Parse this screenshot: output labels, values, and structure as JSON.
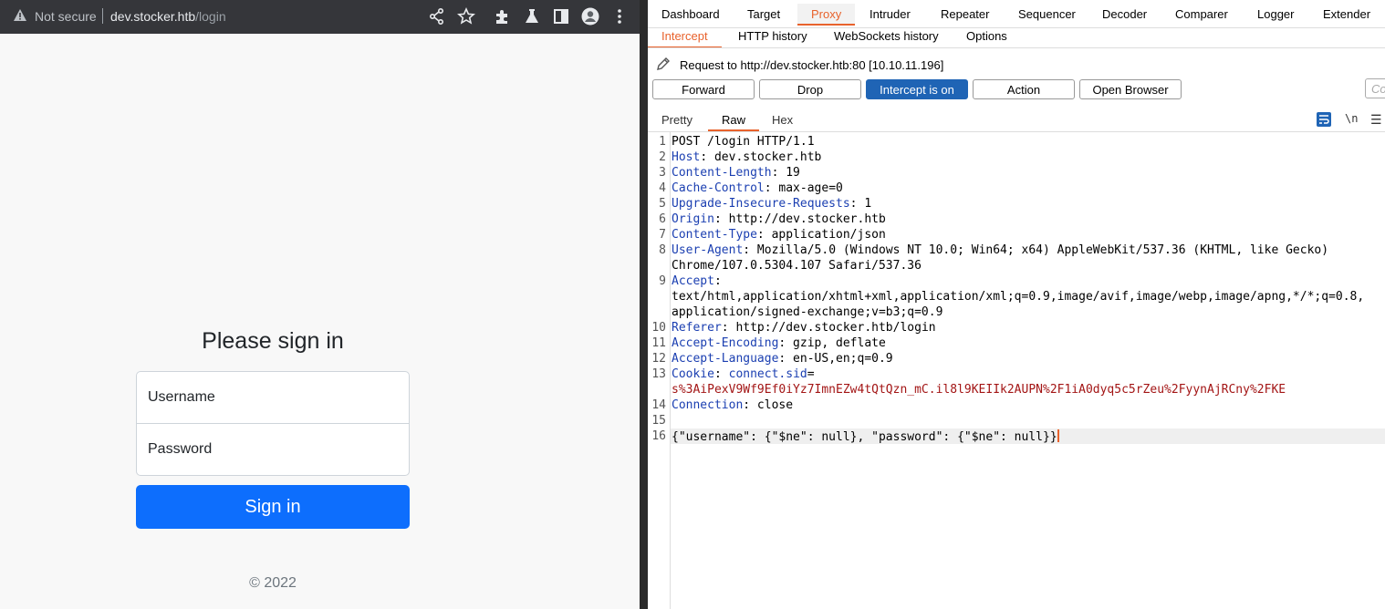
{
  "browser": {
    "security_label": "Not secure",
    "url_host": "dev.stocker.htb",
    "url_path": "/login",
    "toolbar_icons": [
      "share-icon",
      "star-icon",
      "extensions-icon",
      "labs-icon",
      "sidepanel-icon",
      "profile-icon",
      "menu-icon"
    ],
    "page": {
      "title": "Please sign in",
      "username_placeholder": "Username",
      "password_placeholder": "Password",
      "signin_label": "Sign in",
      "copyright": "© 2022"
    }
  },
  "burp": {
    "main_tabs": [
      "Dashboard",
      "Target",
      "Proxy",
      "Intruder",
      "Repeater",
      "Sequencer",
      "Decoder",
      "Comparer",
      "Logger",
      "Extender"
    ],
    "main_active": "Proxy",
    "sub_tabs": [
      "Intercept",
      "HTTP history",
      "WebSockets history",
      "Options"
    ],
    "sub_active": "Intercept",
    "request_info": "Request to http://dev.stocker.htb:80  [10.10.11.196]",
    "buttons": {
      "forward": "Forward",
      "drop": "Drop",
      "intercept": "Intercept is on",
      "action": "Action",
      "open_browser": "Open Browser"
    },
    "comment_placeholder": "Co",
    "view_tabs": [
      "Pretty",
      "Raw",
      "Hex"
    ],
    "view_active": "Raw",
    "view_icons": {
      "newline_label": "\\n"
    },
    "request_lines": [
      {
        "n": "1",
        "text": "POST /login HTTP/1.1"
      },
      {
        "n": "2",
        "key": "Host",
        "val": " dev.stocker.htb"
      },
      {
        "n": "3",
        "key": "Content-Length",
        "val": " 19"
      },
      {
        "n": "4",
        "key": "Cache-Control",
        "val": " max-age=0"
      },
      {
        "n": "5",
        "key": "Upgrade-Insecure-Requests",
        "val": " 1"
      },
      {
        "n": "6",
        "key": "Origin",
        "val": " http://dev.stocker.htb"
      },
      {
        "n": "7",
        "key": "Content-Type",
        "val": " application/json"
      },
      {
        "n": "8",
        "key": "User-Agent",
        "val": " Mozilla/5.0 (Windows NT 10.0; Win64; x64) AppleWebKit/537.36 (KHTML, like Gecko)",
        "cont": [
          "Chrome/107.0.5304.107 Safari/537.36"
        ]
      },
      {
        "n": "9",
        "key": "Accept",
        "val": "",
        "cont": [
          "text/html,application/xhtml+xml,application/xml;q=0.9,image/avif,image/webp,image/apng,*/*;q=0.8,",
          "application/signed-exchange;v=b3;q=0.9"
        ]
      },
      {
        "n": "10",
        "key": "Referer",
        "val": " http://dev.stocker.htb/login"
      },
      {
        "n": "11",
        "key": "Accept-Encoding",
        "val": " gzip, deflate"
      },
      {
        "n": "12",
        "key": "Accept-Language",
        "val": " en-US,en;q=0.9"
      },
      {
        "n": "13",
        "key": "Cookie",
        "cookie_name": "connect.sid",
        "cookie_value": "s%3AiPexV9Wf9Ef0iYz7ImnEZw4tQtQzn_mC.il8l9KEIIk2AUPN%2F1iA0dyq5c5rZeu%2FyynAjRCny%2FKE"
      },
      {
        "n": "14",
        "key": "Connection",
        "val": " close"
      },
      {
        "n": "15",
        "text": ""
      },
      {
        "n": "16",
        "json": "{\"username\": {\"$ne\": null}, \"password\": {\"$ne\": null}}"
      }
    ],
    "colors": {
      "accent": "#e8622c",
      "primary_button": "#1f64b5",
      "header_key": "#1b3fb1",
      "cookie_value": "#a31515"
    }
  }
}
